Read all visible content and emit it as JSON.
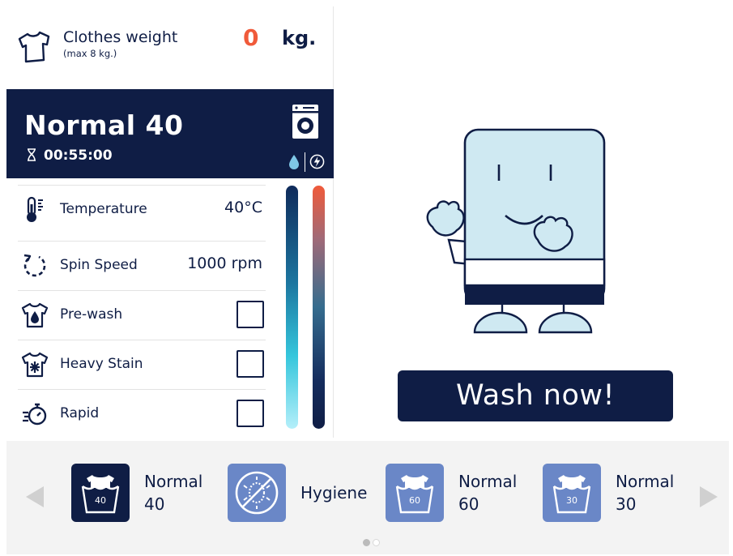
{
  "weight": {
    "title": "Clothes weight",
    "subtitle": "(max 8 kg.)",
    "value": "0",
    "unit": "kg.",
    "value_color": "#f05a3a"
  },
  "program": {
    "name": "Normal 40",
    "time": "00:55:00",
    "icons": [
      "hourglass-icon",
      "washing-machine-icon",
      "water-drop-icon",
      "energy-bolt-icon"
    ]
  },
  "settings": [
    {
      "label": "Temperature",
      "value": "40°C",
      "icon": "thermometer-icon"
    },
    {
      "label": "Spin Speed",
      "value": "1000 rpm",
      "icon": "spin-arrow-icon"
    },
    {
      "label": "Pre-wash",
      "icon": "shirt-drop-icon",
      "checked": false
    },
    {
      "label": "Heavy Stain",
      "icon": "shirt-stain-icon",
      "checked": false
    },
    {
      "label": "Rapid",
      "icon": "stopwatch-icon",
      "checked": false
    }
  ],
  "action": {
    "wash_label": "Wash now!"
  },
  "programs": [
    {
      "line1": "Normal",
      "line2": "40",
      "tile_text": "40",
      "active": true,
      "icon": "wash-tub-icon"
    },
    {
      "line1": "Hygiene",
      "line2": "",
      "tile_text": "",
      "active": false,
      "icon": "no-bacteria-icon"
    },
    {
      "line1": "Normal",
      "line2": "60",
      "tile_text": "60",
      "active": false,
      "icon": "wash-tub-icon"
    },
    {
      "line1": "Normal",
      "line2": "30",
      "tile_text": "30",
      "active": false,
      "icon": "wash-tub-icon"
    }
  ],
  "pagination": {
    "current": 1,
    "total": 2
  },
  "colors": {
    "navy": "#0f1d45",
    "accent_red": "#f05a3a",
    "tile_inactive": "#6a87c7",
    "mascot_body": "#cfe9f2"
  }
}
